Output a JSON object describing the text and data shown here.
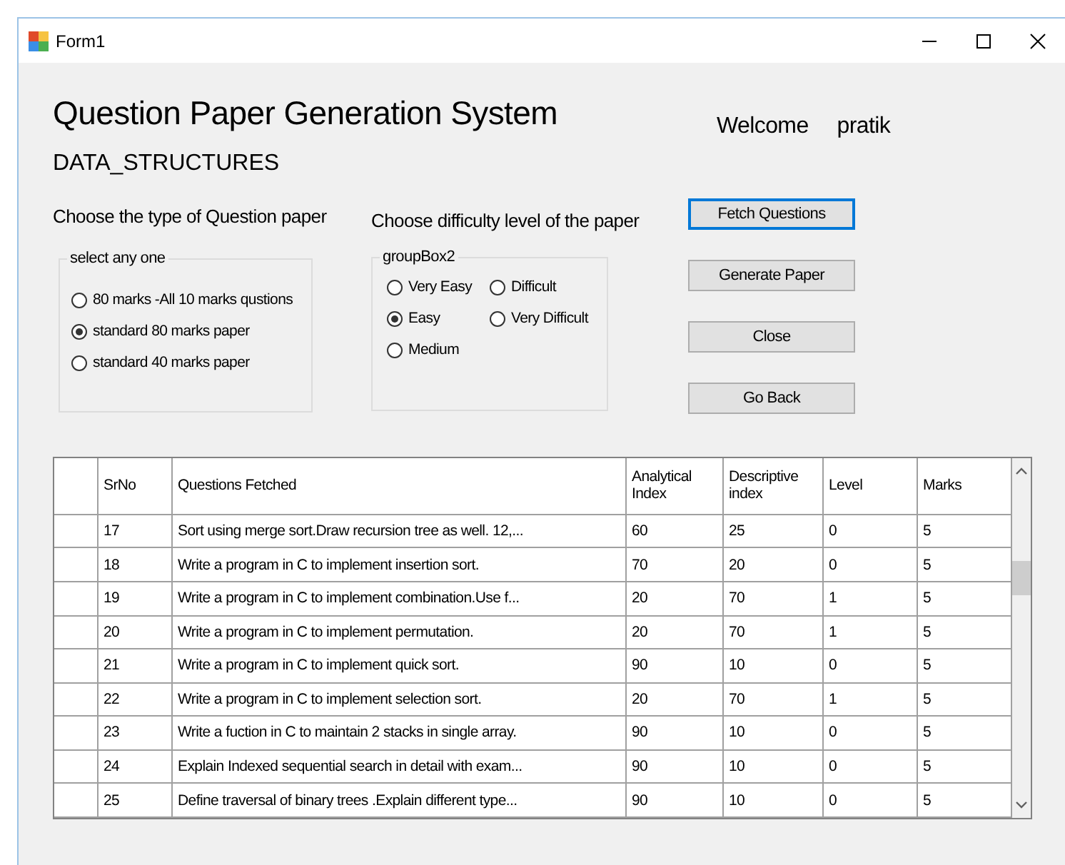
{
  "window": {
    "title": "Form1"
  },
  "heading": "Question Paper Generation System",
  "subject": "DATA_STRUCTURES",
  "welcome": {
    "label": "Welcome",
    "user": "pratik"
  },
  "paper_type": {
    "prompt": "Choose the type of Question paper",
    "group_title": "select any one",
    "options": [
      {
        "label": "80 marks -All 10 marks qustions",
        "selected": false
      },
      {
        "label": "standard 80 marks paper",
        "selected": true
      },
      {
        "label": "standard 40 marks paper",
        "selected": false
      }
    ]
  },
  "difficulty": {
    "prompt": "Choose difficulty level of the paper",
    "group_title": "groupBox2",
    "options": [
      {
        "label": "Very Easy",
        "selected": false
      },
      {
        "label": "Difficult",
        "selected": false
      },
      {
        "label": "Easy",
        "selected": true
      },
      {
        "label": "Very Difficult",
        "selected": false
      },
      {
        "label": "Medium",
        "selected": false
      }
    ]
  },
  "buttons": [
    {
      "label": "Fetch Questions",
      "focused": true
    },
    {
      "label": "Generate Paper",
      "focused": false
    },
    {
      "label": "Close",
      "focused": false
    },
    {
      "label": "Go Back",
      "focused": false
    }
  ],
  "table": {
    "columns": [
      "SrNo",
      "Questions Fetched",
      "Analytical Index",
      "Descriptive index",
      "Level",
      "Marks"
    ],
    "rows": [
      [
        "17",
        "Sort using merge sort.Draw recursion tree as well. 12,...",
        "60",
        "25",
        "0",
        "5"
      ],
      [
        "18",
        "Write a program in C to implement insertion sort.",
        "70",
        "20",
        "0",
        "5"
      ],
      [
        "19",
        "Write a program in C to implement combination.Use f...",
        "20",
        "70",
        "1",
        "5"
      ],
      [
        "20",
        "Write a program in C to implement permutation.",
        "20",
        "70",
        "1",
        "5"
      ],
      [
        "21",
        "Write a program in C to implement quick sort.",
        "90",
        "10",
        "0",
        "5"
      ],
      [
        "22",
        "Write a program in C to implement selection sort.",
        "20",
        "70",
        "1",
        "5"
      ],
      [
        "23",
        "Write a fuction in C to maintain 2 stacks in single array.",
        "90",
        "10",
        "0",
        "5"
      ],
      [
        "24",
        "Explain Indexed sequential search in detail with exam...",
        "90",
        "10",
        "0",
        "5"
      ],
      [
        "25",
        "Define traversal of binary trees .Explain different type...",
        "90",
        "10",
        "0",
        "5"
      ]
    ]
  }
}
